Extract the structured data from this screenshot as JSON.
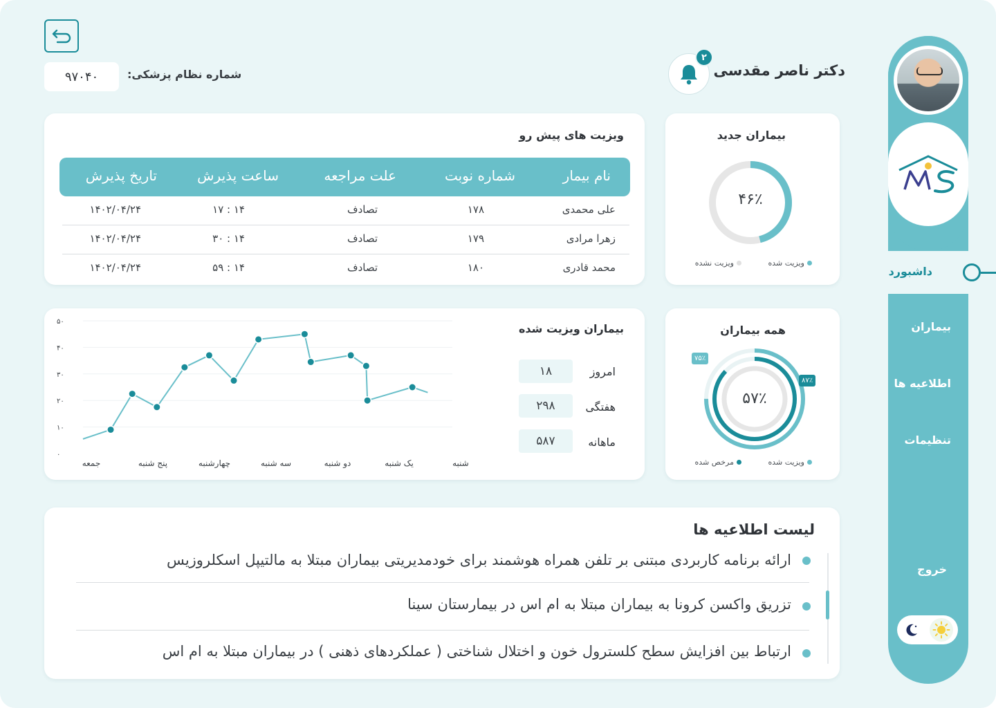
{
  "header": {
    "doctor_name": "دکتر ناصر مقدسی",
    "notification_count": "۲",
    "medical_number_label": "شماره نظام پزشکی:",
    "medical_number_value": "۹۷۰۴۰"
  },
  "sidebar": {
    "items": [
      {
        "label": "داشبورد",
        "active": true
      },
      {
        "label": "بیماران"
      },
      {
        "label": "اطلاعیه ها"
      },
      {
        "label": "تنظیمات"
      },
      {
        "label": "خروج"
      }
    ]
  },
  "new_patients": {
    "title": "بیماران جدید",
    "percent_label": "۴۶٪",
    "percent_value": 46,
    "legend_visited": "ویزیت شده",
    "legend_not_visited": "ویزیت نشده",
    "colors": {
      "visited": "#69bfc9",
      "not_visited": "#e6e6e6"
    }
  },
  "upcoming_visits": {
    "title": "ویزیت های پیش رو",
    "columns": [
      "نام بیمار",
      "شماره نوبت",
      "علت مراجعه",
      "ساعت پذیرش",
      "تاریخ پذیرش"
    ],
    "rows": [
      {
        "name": "علی محمدی",
        "number": "۱۷۸",
        "reason": "تصادف",
        "time": "۱۴ : ۱۷",
        "date": "۱۴۰۲/۰۴/۲۴"
      },
      {
        "name": "زهرا مرادی",
        "number": "۱۷۹",
        "reason": "تصادف",
        "time": "۱۴ : ۳۰",
        "date": "۱۴۰۲/۰۴/۲۴"
      },
      {
        "name": "محمد قادری",
        "number": "۱۸۰",
        "reason": "تصادف",
        "time": "۱۴ : ۵۹",
        "date": "۱۴۰۲/۰۴/۲۴"
      }
    ]
  },
  "all_patients": {
    "title": "همه بیماران",
    "center_label": "۵۷٪",
    "outer_tag": "۷۵٪",
    "inner_tag": "۸۷٪",
    "outer_value": 75,
    "inner_value": 87,
    "legend_visited": "ویزیت شده",
    "legend_discharged": "مرخص شده",
    "colors": {
      "visited": "#69bfc9",
      "discharged": "#1a8c99"
    }
  },
  "visited_patients": {
    "title": "بیماران ویزیت شده",
    "stats": [
      {
        "label": "امروز",
        "value": "۱۸"
      },
      {
        "label": "هفتگی",
        "value": "۲۹۸"
      },
      {
        "label": "ماهانه",
        "value": "۵۸۷"
      }
    ]
  },
  "chart_data": {
    "type": "line",
    "title": "",
    "xlabel": "",
    "ylabel": "",
    "ylim": [
      0,
      50
    ],
    "y_ticks": [
      "۰",
      "۱۰",
      "۲۰",
      "۳۰",
      "۴۰",
      "۵۰"
    ],
    "x_ticks": [
      "جمعه",
      "پنج شنبه",
      "چهارشنبه",
      "سه شنبه",
      "دو شنبه",
      "یک شنبه",
      "شنبه"
    ],
    "grid": true,
    "color": "#69bfc9",
    "point_color": "#1a8c99",
    "series": [
      {
        "x": [
          0.0,
          0.45,
          0.8,
          1.2,
          1.65,
          2.05,
          2.45,
          2.85,
          3.6,
          3.7,
          4.35,
          4.6,
          4.62,
          5.35,
          5.6
        ],
        "values": [
          5.5,
          9,
          22.5,
          17.5,
          32.5,
          37,
          27.5,
          43,
          45,
          34.5,
          37,
          33,
          20,
          25,
          23
        ]
      }
    ],
    "marked_points": [
      1,
      2,
      3,
      4,
      5,
      6,
      7,
      8,
      9,
      10,
      11,
      12,
      13
    ]
  },
  "news": {
    "title": "لیست اطلاعیه ها",
    "items": [
      "ارائه برنامه کاربردی مبتنی بر تلفن همراه هوشمند برای خودمدیریتی بیماران مبتلا به مالتیپل اسکلروزیس",
      "تزریق واکسن کرونا به بیماران مبتلا به ام اس در بیمارستان سینا",
      "ارتباط بین افزایش سطح کلسترول خون و اختلال شناختی ( عملکردهای ذهنی ) در بیماران مبتلا به ام اس"
    ]
  },
  "icons": {
    "back": "back-arrow-icon",
    "bell": "bell-icon",
    "moon": "moon-icon",
    "sun": "sun-icon",
    "logo": "ms-logo"
  }
}
